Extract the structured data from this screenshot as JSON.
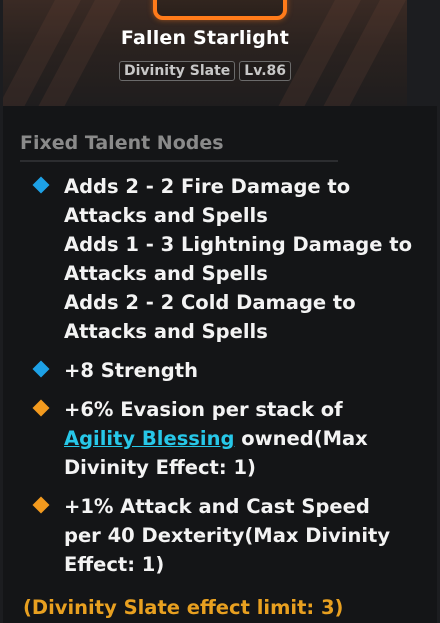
{
  "item": {
    "name": "Fallen Starlight",
    "type_tag": "Divinity Slate",
    "level_tag": "Lv.86"
  },
  "section_title": "Fixed Talent Nodes",
  "nodes": [
    {
      "diamond_color": "#1da1e6",
      "lines": [
        "Adds 2 - 2 Fire Damage to",
        "Attacks and Spells",
        "Adds 1 - 3 Lightning Damage to",
        "Attacks and Spells",
        "Adds 2 - 2 Cold Damage to",
        "Attacks and Spells"
      ]
    },
    {
      "diamond_color": "#1da1e6",
      "lines": [
        "+8 Strength"
      ]
    },
    {
      "diamond_color": "#f39a1e",
      "line1": "+6% Evasion per stack of",
      "link": "Agility Blessing",
      "line2_suffix": " owned(Max",
      "line3": "Divinity Effect: 1)"
    },
    {
      "diamond_color": "#f39a1e",
      "lines": [
        "+1% Attack and Cast Speed",
        "per 40 Dexterity(Max Divinity",
        "Effect: 1)"
      ]
    }
  ],
  "limit_text": "(Divinity Slate effect limit: 3)"
}
